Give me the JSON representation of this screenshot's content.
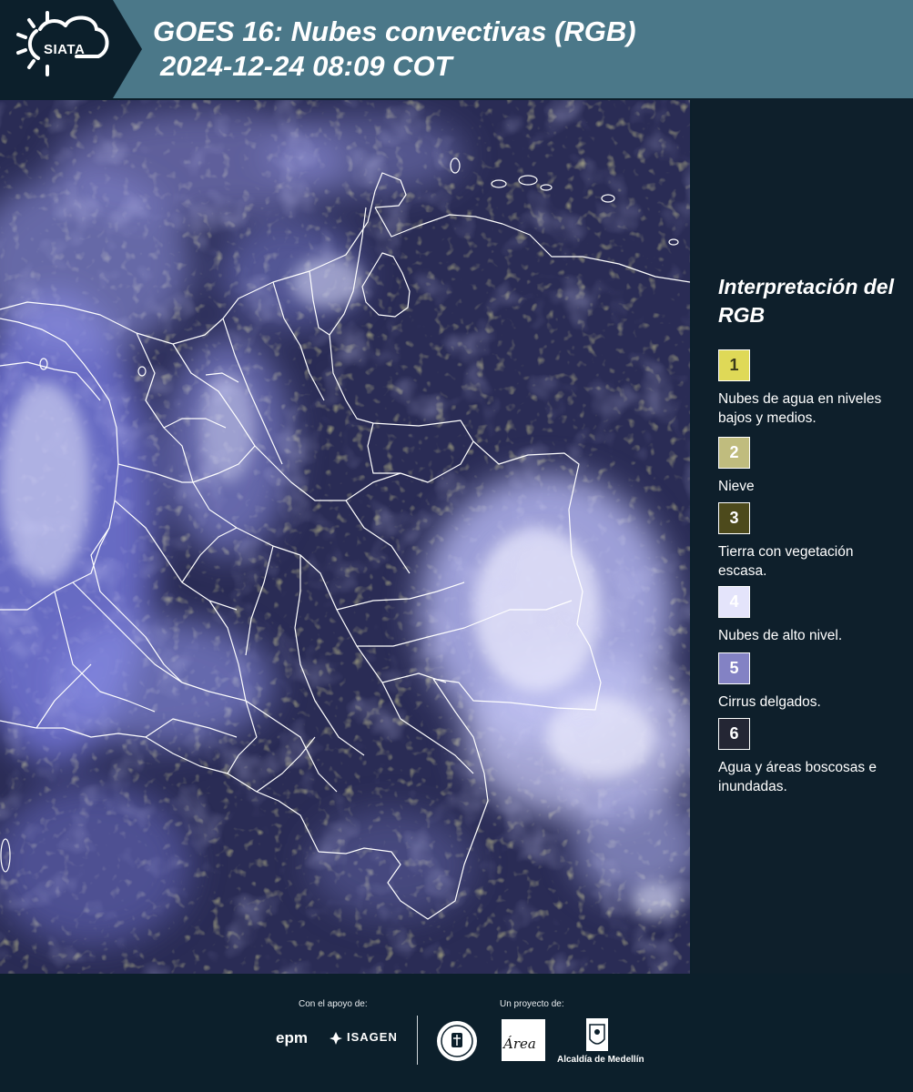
{
  "header": {
    "logo_text": "SIATA",
    "title_line1": "GOES 16: Nubes convectivas (RGB)",
    "title_line2": "2024-12-24 08:09 COT"
  },
  "legend": {
    "title": "Interpretación del RGB",
    "items": [
      {
        "number": "1",
        "label": "Nubes de agua en niveles bajos y medios.",
        "color": "#dfd957",
        "text_color": "#3a3a1a"
      },
      {
        "number": "2",
        "label": "Nieve",
        "color": "#c0bc7e",
        "text_color": "#ffffff"
      },
      {
        "number": "3",
        "label": "Tierra con vegetación escasa.",
        "color": "#4d4a1c",
        "text_color": "#ffffff"
      },
      {
        "number": "4",
        "label": "Nubes de alto nivel.",
        "color": "#e4e4fb",
        "text_color": "#ffffff"
      },
      {
        "number": "5",
        "label": "Cirrus delgados.",
        "color": "#8382c4",
        "text_color": "#ffffff"
      },
      {
        "number": "6",
        "label": "Agua y áreas boscosas e inundadas.",
        "color": "#242634",
        "text_color": "#ffffff"
      }
    ]
  },
  "footer": {
    "support_label": "Con el apoyo de:",
    "project_label": "Un proyecto de:",
    "epm": "epm",
    "isagen": "ISAGEN",
    "area_logo": "Área",
    "alcaldia": "Alcaldía de Medellín"
  }
}
